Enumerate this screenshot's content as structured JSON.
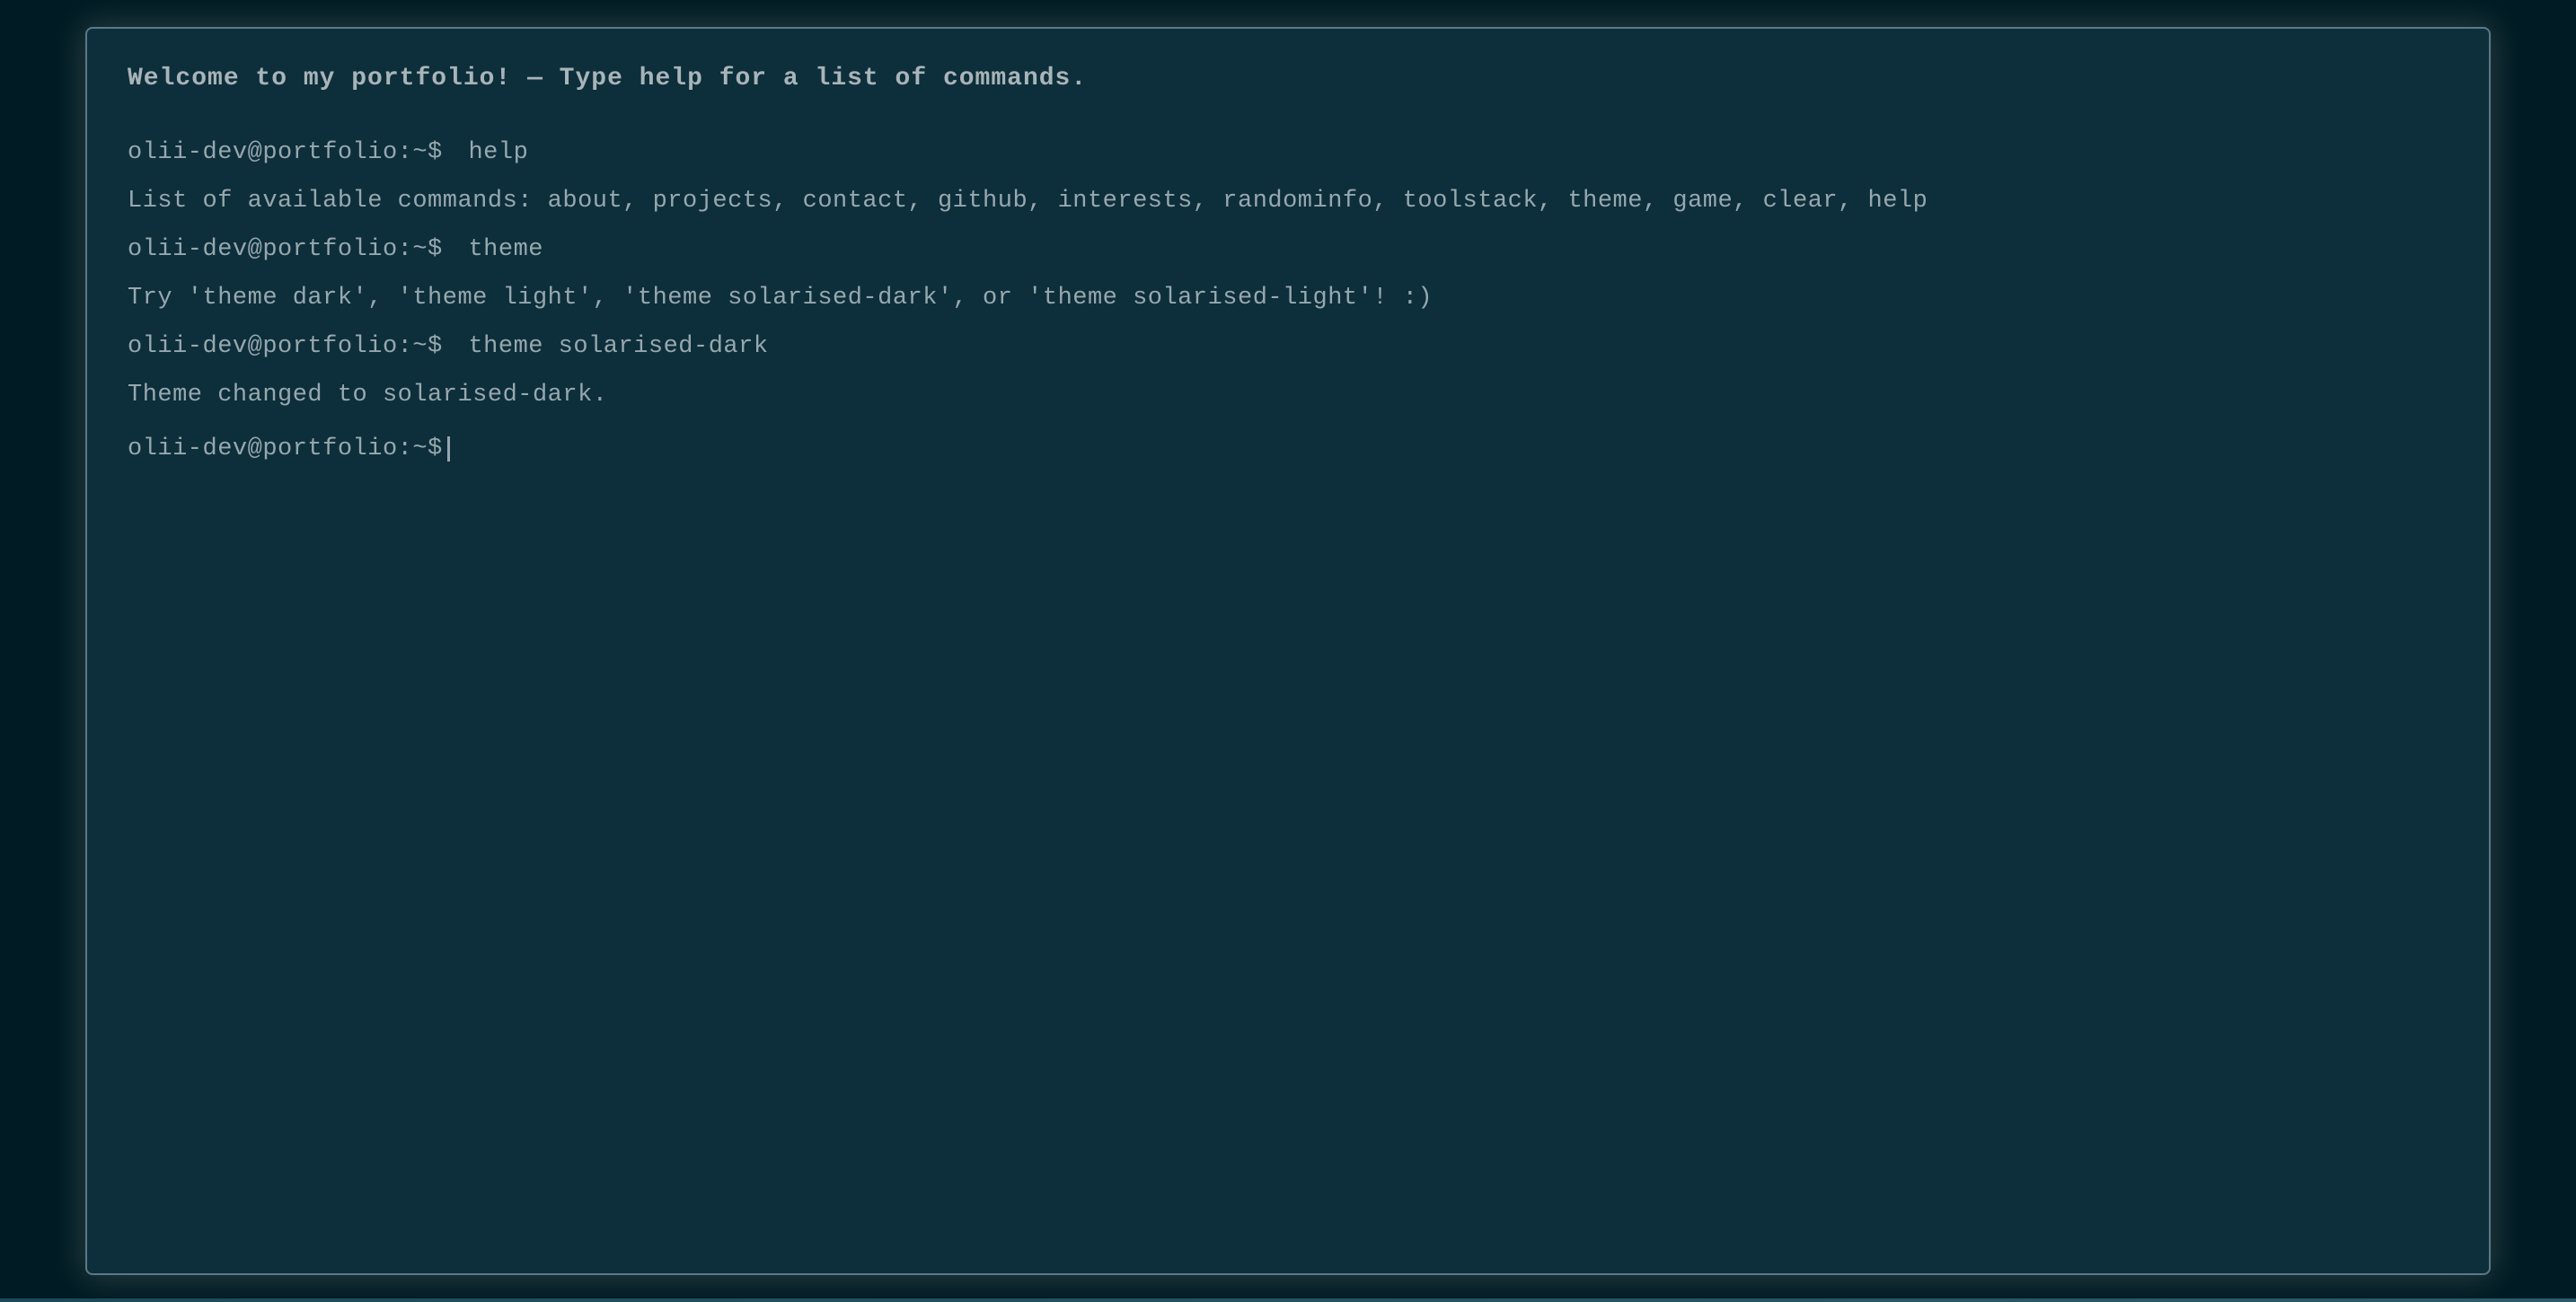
{
  "terminal": {
    "welcome": "Welcome to my portfolio! — Type help for a list of commands.",
    "prompt": "olii-dev@portfolio:~$",
    "history": [
      {
        "prompt": "olii-dev@portfolio:~$",
        "command": "help",
        "output": "List of available commands: about, projects, contact, github, interests, randominfo, toolstack, theme, game, clear, help"
      },
      {
        "prompt": "olii-dev@portfolio:~$",
        "command": "theme",
        "output": "Try 'theme dark', 'theme light', 'theme solarised-dark', or 'theme solarised-light'! :)"
      },
      {
        "prompt": "olii-dev@portfolio:~$",
        "command": "theme solarised-dark",
        "output": "Theme changed to solarised-dark."
      }
    ],
    "current_input": ""
  },
  "colors": {
    "background": "#001b24",
    "terminal_bg": "#0d2e3b",
    "border": "#5a7a85",
    "text": "#97a8ad",
    "welcome_text": "#a8b4b8"
  }
}
